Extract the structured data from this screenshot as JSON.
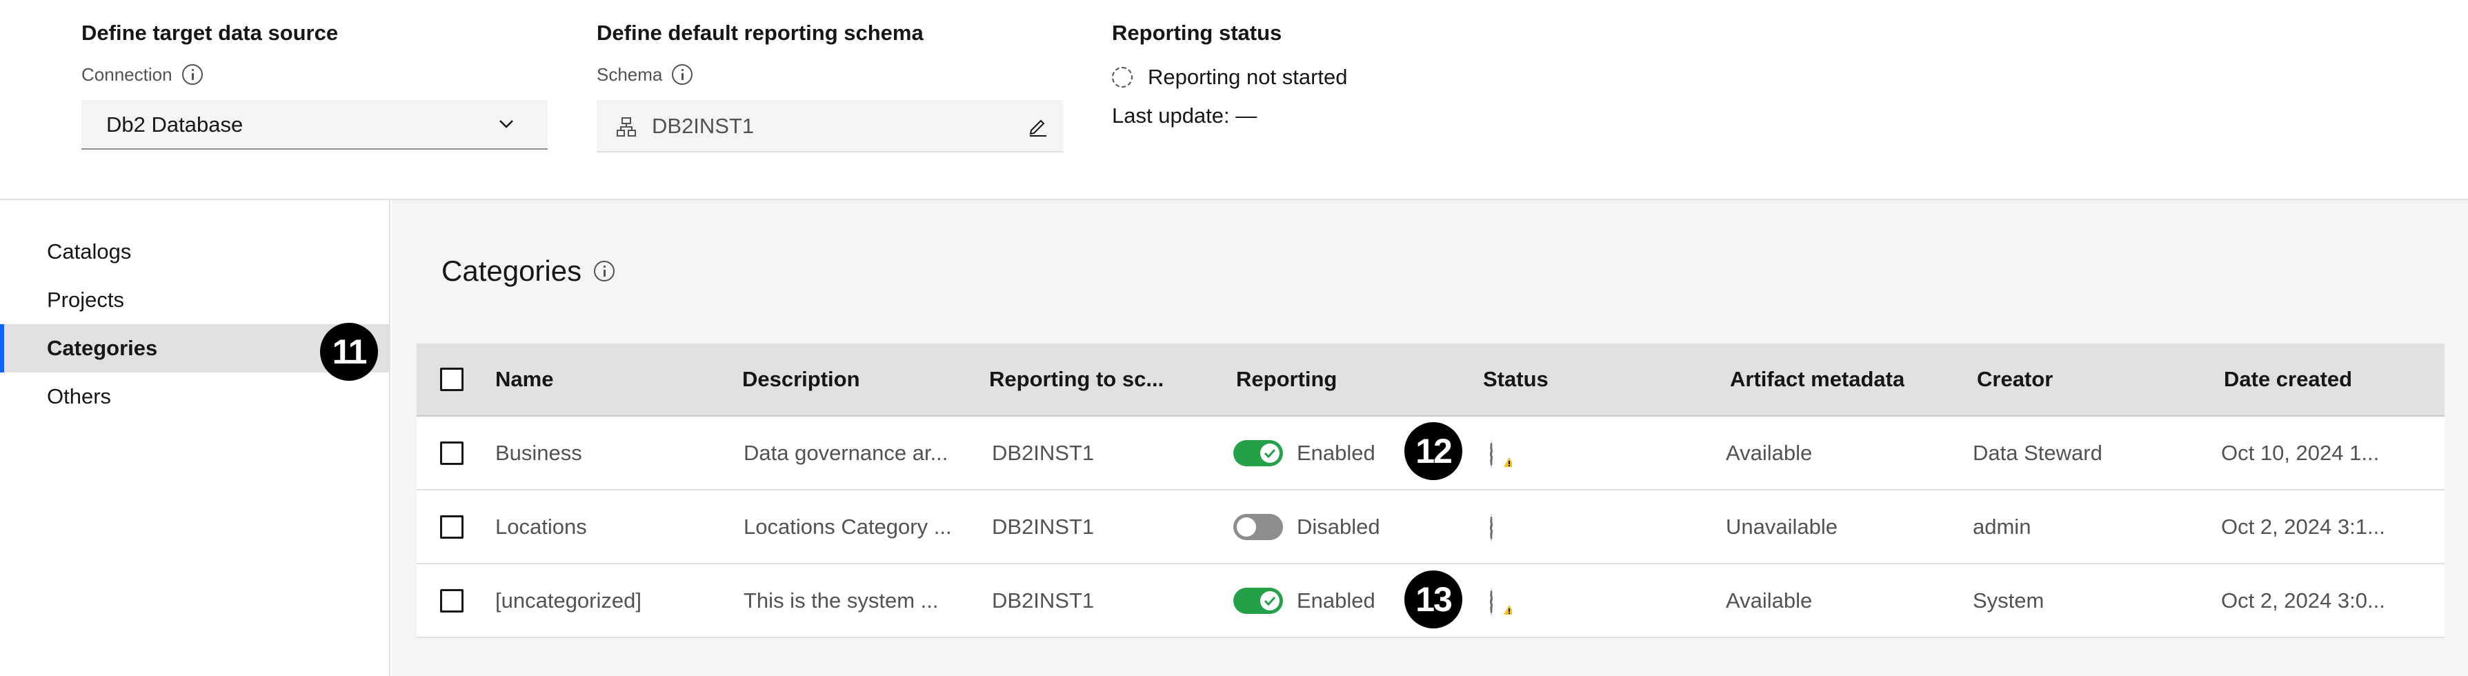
{
  "target": {
    "title": "Define target data source",
    "connection_label": "Connection",
    "connection_value": "Db2 Database"
  },
  "schema": {
    "title": "Define default reporting schema",
    "schema_label": "Schema",
    "schema_value": "DB2INST1"
  },
  "status": {
    "title": "Reporting status",
    "state": "Reporting not started",
    "last_update": "Last update: —"
  },
  "sidebar": {
    "items": [
      {
        "label": "Catalogs"
      },
      {
        "label": "Projects"
      },
      {
        "label": "Categories"
      },
      {
        "label": "Others"
      }
    ]
  },
  "main": {
    "title": "Categories"
  },
  "table": {
    "headers": [
      "Name",
      "Description",
      "Reporting to sc...",
      "Reporting",
      "Status",
      "Artifact metadata",
      "Creator",
      "Date created"
    ],
    "rows": [
      {
        "name": "Business",
        "description": "Data governance ar...",
        "reporting_to": "DB2INST1",
        "reporting": "Enabled",
        "reporting_on": true,
        "status_warning": true,
        "metadata": "Available",
        "creator": "Data Steward",
        "date": "Oct 10, 2024 1..."
      },
      {
        "name": "Locations",
        "description": "Locations Category ...",
        "reporting_to": "DB2INST1",
        "reporting": "Disabled",
        "reporting_on": false,
        "status_warning": false,
        "metadata": "Unavailable",
        "creator": "admin",
        "date": "Oct 2, 2024 3:1..."
      },
      {
        "name": "[uncategorized]",
        "description": "This is the system ...",
        "reporting_to": "DB2INST1",
        "reporting": "Enabled",
        "reporting_on": true,
        "status_warning": true,
        "metadata": "Available",
        "creator": "System",
        "date": "Oct 2, 2024 3:0..."
      }
    ]
  },
  "annotations": {
    "badge_sidebar": "11",
    "badge_row1": "12",
    "badge_row3": "13"
  },
  "colors": {
    "accent": "#0f62fe",
    "toggle_on": "#24a148",
    "toggle_off": "#8d8d8d",
    "warning": "#f1c21b"
  }
}
